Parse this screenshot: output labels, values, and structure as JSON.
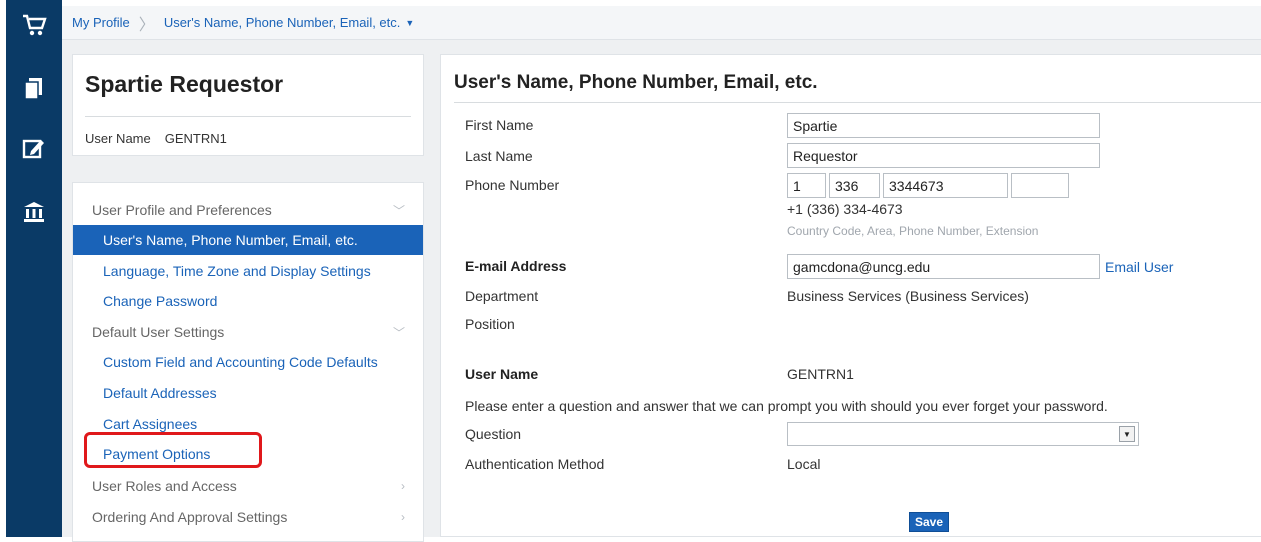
{
  "icons": [
    "cart-icon",
    "documents-icon",
    "edit-icon",
    "bank-icon"
  ],
  "breadcrumb": {
    "root": "My Profile",
    "current": "User's Name, Phone Number, Email, etc."
  },
  "profile": {
    "display_name": "Spartie Requestor",
    "user_name_label": "User Name",
    "user_name_value": "GENTRN1"
  },
  "nav": {
    "sec1": "User Profile and Preferences",
    "l1": "User's Name, Phone Number, Email, etc.",
    "l2": "Language, Time Zone and Display Settings",
    "l3": "Change Password",
    "sec2": "Default User Settings",
    "l4": "Custom Field and Accounting Code Defaults",
    "l5": "Default Addresses",
    "l6": "Cart Assignees",
    "l7": "Payment Options",
    "sec3": "User Roles and Access",
    "sec4": "Ordering And Approval Settings"
  },
  "form": {
    "title": "User's Name, Phone Number, Email, etc.",
    "first_name_label": "First Name",
    "first_name": "Spartie",
    "last_name_label": "Last Name",
    "last_name": "Requestor",
    "phone_label": "Phone Number",
    "phone_country": "1",
    "phone_area": "336",
    "phone_number": "3344673",
    "phone_ext": "",
    "phone_formatted": "+1 (336) 334-4673",
    "phone_hint": "Country Code, Area, Phone Number, Extension",
    "email_label": "E-mail Address",
    "email": "gamcdona@uncg.edu",
    "email_user_link": "Email User",
    "department_label": "Department",
    "department": "Business Services (Business Services)",
    "position_label": "Position",
    "user_name_label": "User Name",
    "user_name": "GENTRN1",
    "question_prompt": "Please enter a question and answer that we can prompt you with should you ever forget your password.",
    "question_label": "Question",
    "question_value": "",
    "auth_label": "Authentication Method",
    "auth_value": "Local",
    "save_label": "Save"
  },
  "colors": {
    "sidebar": "#0a3a66",
    "accent": "#1a63b8",
    "highlight": "#e0181b"
  }
}
